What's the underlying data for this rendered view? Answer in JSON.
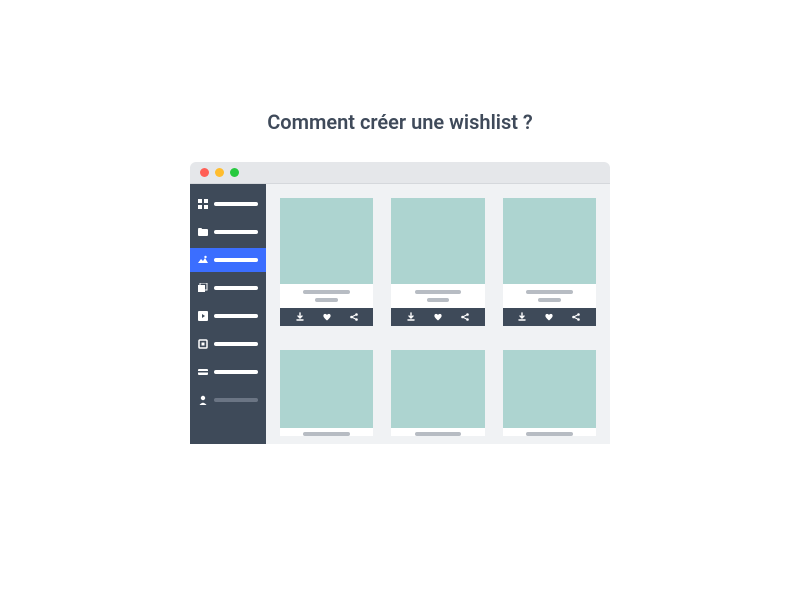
{
  "title": "Comment créer une wishlist ?",
  "sidebar": {
    "items": [
      {
        "icon": "grid-icon",
        "active": false
      },
      {
        "icon": "folder-icon",
        "active": false
      },
      {
        "icon": "image-icon",
        "active": true
      },
      {
        "icon": "albums-icon",
        "active": false
      },
      {
        "icon": "play-icon",
        "active": false
      },
      {
        "icon": "box-icon",
        "active": false
      },
      {
        "icon": "card-icon",
        "active": false
      },
      {
        "icon": "person-icon",
        "active": false
      }
    ]
  },
  "grid": {
    "row1_actions": [
      "download",
      "heart",
      "share"
    ]
  }
}
